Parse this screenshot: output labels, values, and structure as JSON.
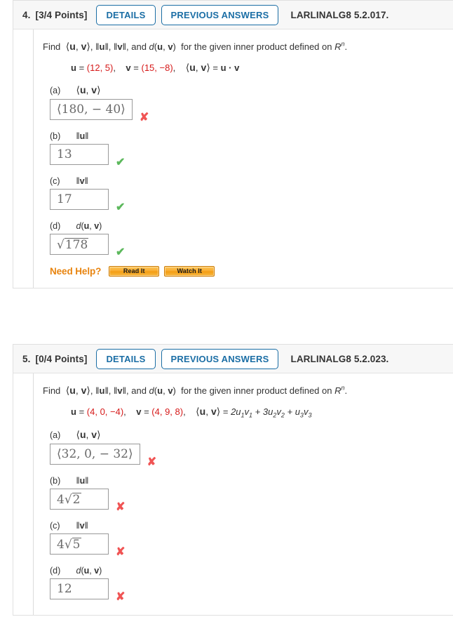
{
  "questions": [
    {
      "number": "4.",
      "points": "[3/4 Points]",
      "details_label": "DETAILS",
      "previous_answers_label": "PREVIOUS ANSWERS",
      "code": "LARLINALG8 5.2.017.",
      "prompt_lead": "Find",
      "prompt_tail": "for the given inner product defined on",
      "prompt_space": "R",
      "prompt_space_sup": "n",
      "prompt_period": ".",
      "given_u_label": "u",
      "given_u_value": "(12, 5)",
      "given_v_label": "v",
      "given_v_value": "(15, −8)",
      "inner_product_def": "u · v",
      "parts": [
        {
          "tag": "(a)",
          "label": "⟨u, v⟩",
          "value": "⟨180, − 40⟩",
          "correct": false,
          "wide": true,
          "kind": "plain"
        },
        {
          "tag": "(b)",
          "label": "‖u‖",
          "value": "13",
          "correct": true,
          "wide": false,
          "kind": "plain"
        },
        {
          "tag": "(c)",
          "label": "‖v‖",
          "value": "17",
          "correct": true,
          "wide": false,
          "kind": "plain"
        },
        {
          "tag": "(d)",
          "label": "d(u, v)",
          "value": "178",
          "correct": true,
          "wide": false,
          "kind": "sqrt",
          "coef": ""
        }
      ],
      "need_help": {
        "label": "Need Help?",
        "read_it": "Read It",
        "watch_it": "Watch It"
      },
      "has_need_help": true
    },
    {
      "number": "5.",
      "points": "[0/4 Points]",
      "details_label": "DETAILS",
      "previous_answers_label": "PREVIOUS ANSWERS",
      "code": "LARLINALG8 5.2.023.",
      "prompt_lead": "Find",
      "prompt_tail": "for the given inner product defined on",
      "prompt_space": "R",
      "prompt_space_sup": "n",
      "prompt_period": ".",
      "given_u_label": "u",
      "given_u_value": "(4, 0, −4)",
      "given_v_label": "v",
      "given_v_value": "(4, 9, 8)",
      "inner_product_def": "2u1v1 + 3u2v2 + u3v3",
      "parts": [
        {
          "tag": "(a)",
          "label": "⟨u, v⟩",
          "value": "⟨32, 0, − 32⟩",
          "correct": false,
          "wide": true,
          "kind": "plain"
        },
        {
          "tag": "(b)",
          "label": "‖u‖",
          "value": "2",
          "correct": false,
          "wide": false,
          "kind": "sqrt",
          "coef": "4"
        },
        {
          "tag": "(c)",
          "label": "‖v‖",
          "value": "5",
          "correct": false,
          "wide": false,
          "kind": "sqrt",
          "coef": "4"
        },
        {
          "tag": "(d)",
          "label": "d(u, v)",
          "value": "12",
          "correct": false,
          "wide": false,
          "kind": "plain"
        }
      ],
      "has_need_help": false
    }
  ],
  "symbols": {
    "check": "✔",
    "cross": "✘"
  },
  "colors": {
    "accent_blue": "#1b6ea5",
    "header_bg": "#f7f7f7",
    "correct_green": "#5cb85c",
    "wrong_red": "#f05454",
    "help_orange": "#e8840f",
    "red_value": "#d61a1a"
  }
}
